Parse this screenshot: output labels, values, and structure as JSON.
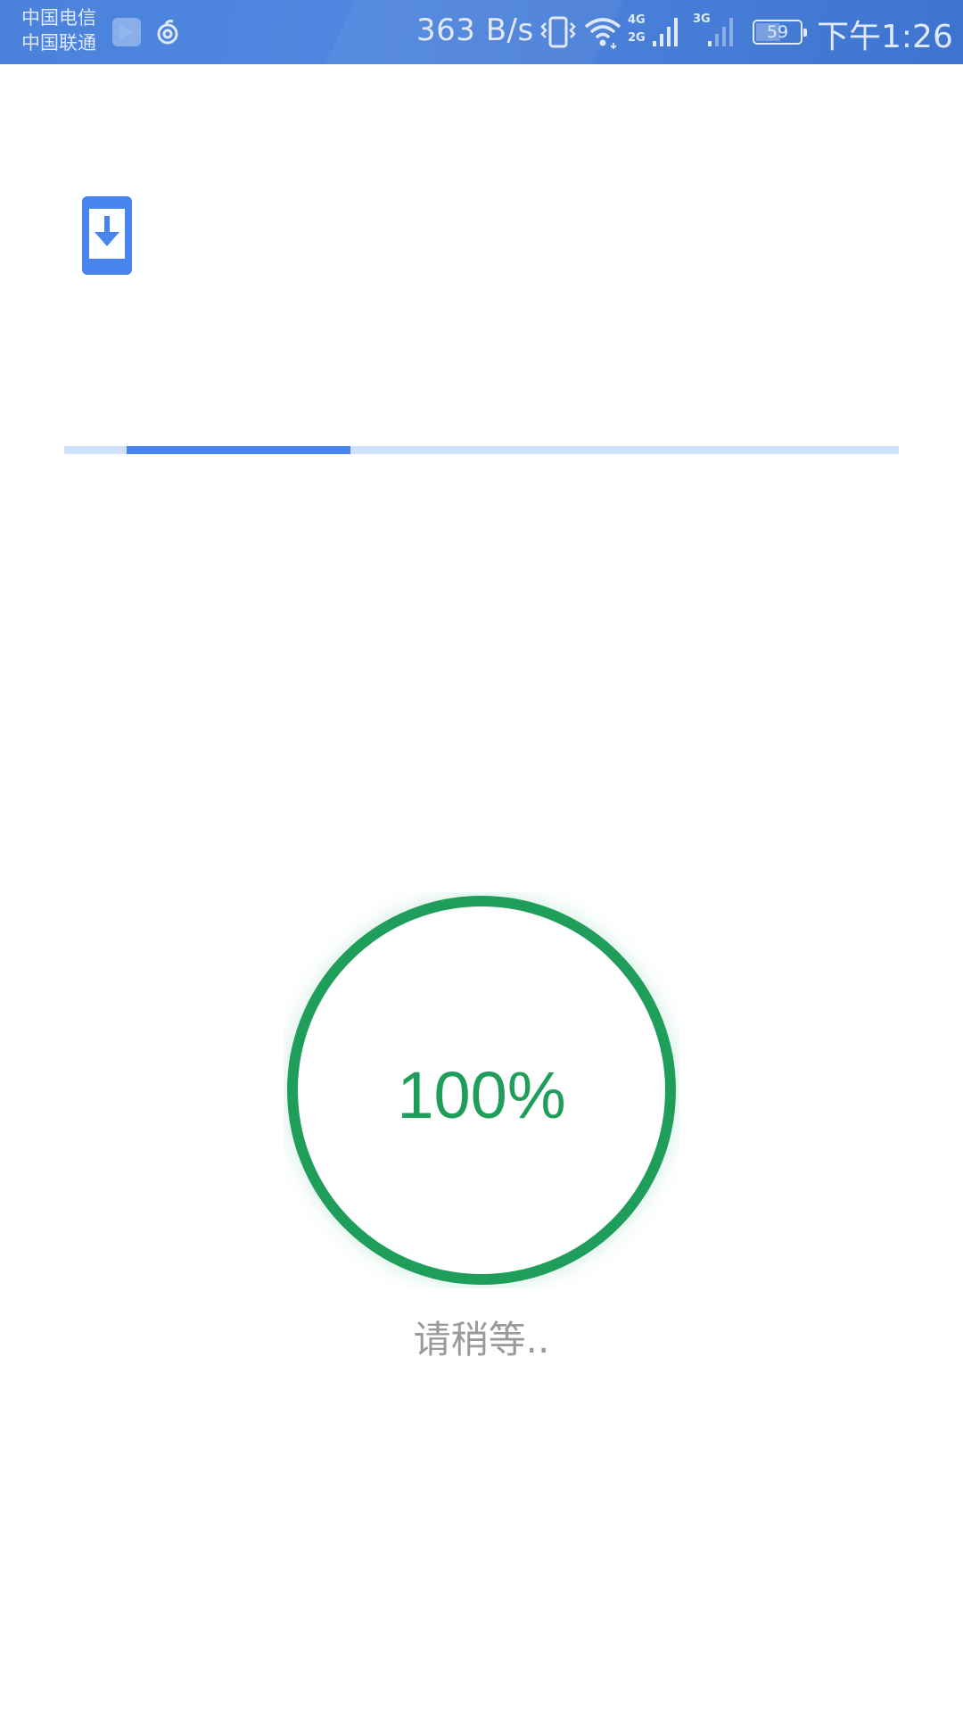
{
  "status_bar": {
    "carrier_1": "中国电信",
    "carrier_2": "中国联通",
    "speed": "363 B/s",
    "net_1_top": "4G",
    "net_1_bottom": "2G",
    "net_2": "3G",
    "battery_level": "59",
    "battery_fraction": 0.59,
    "time": "下午1:26",
    "text_color": "#dfe9fa",
    "background_color": "#4a82dc"
  },
  "app": {
    "download_icon": "phone-download-icon",
    "icon_color": "#4785ec",
    "progress": {
      "start_fraction": 0.075,
      "end_fraction": 0.343,
      "track_color": "#cfe1fa",
      "fill_color": "#4785ec"
    },
    "ring": {
      "percent_text": "100%",
      "color": "#1e9e5a"
    },
    "wait_text": "请稍等.."
  }
}
